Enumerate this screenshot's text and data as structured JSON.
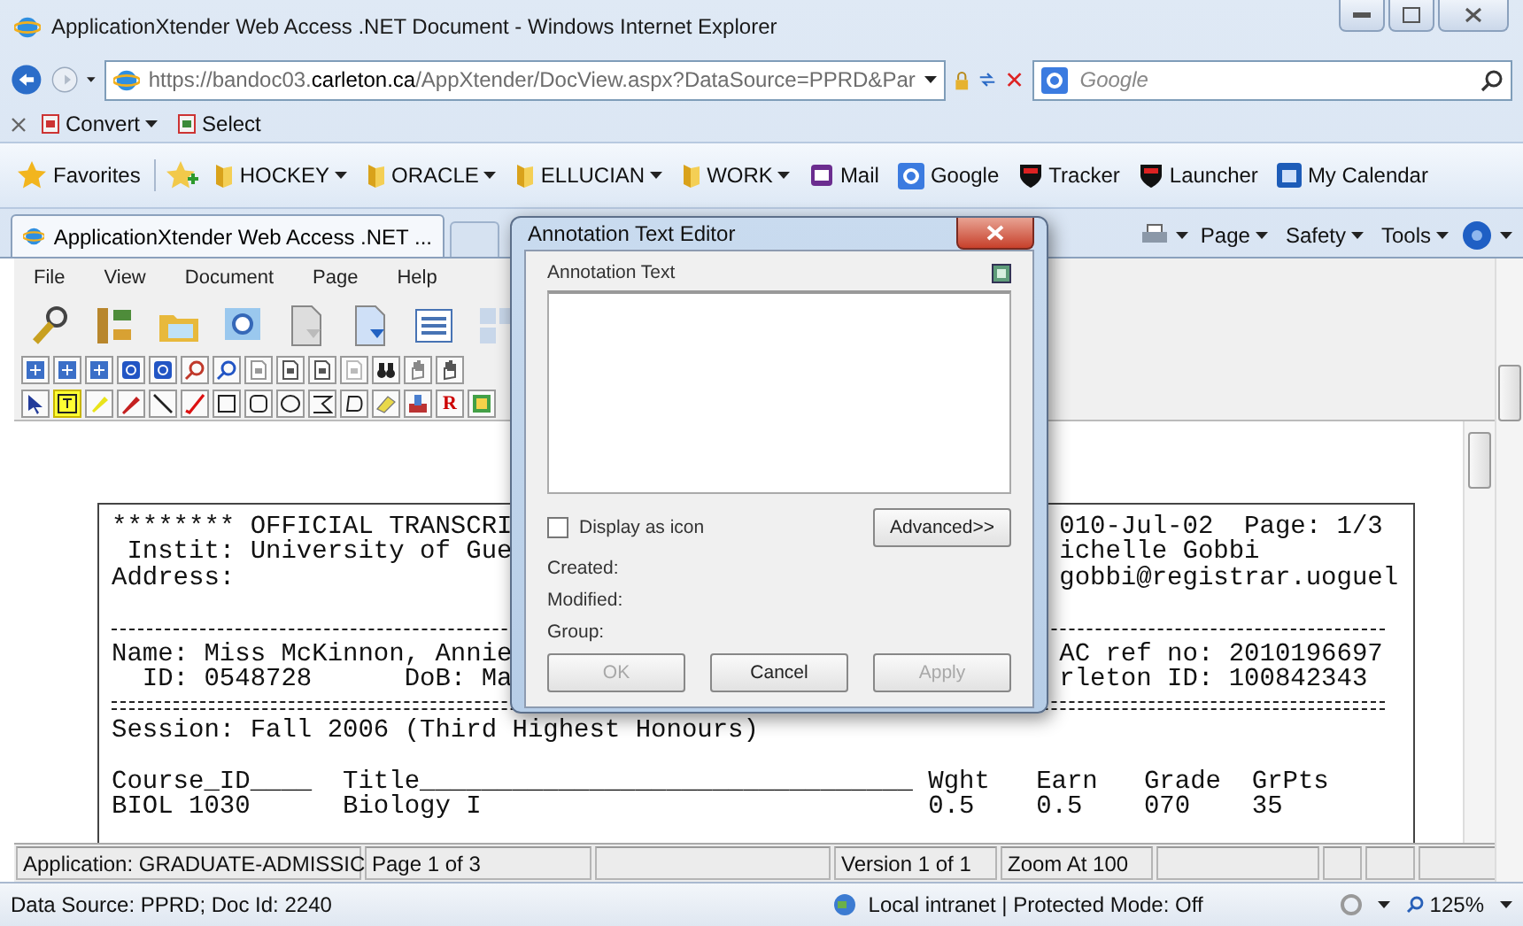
{
  "window": {
    "title": "ApplicationXtender Web Access .NET Document - Windows Internet Explorer"
  },
  "address_bar": {
    "url": "https://bandoc03.**carleton.ca**/AppXtender/DocView.aspx?DataSource=PPRD&Par"
  },
  "search": {
    "placeholder": "Google"
  },
  "command_bar": [
    {
      "label": "Convert",
      "has_menu": true
    },
    {
      "label": "Select",
      "has_menu": false
    }
  ],
  "favorites_bar": {
    "label": "Favorites",
    "items": [
      {
        "label": "HOCKEY",
        "kind": "folder",
        "has_menu": true
      },
      {
        "label": "ORACLE",
        "kind": "folder",
        "has_menu": true
      },
      {
        "label": "ELLUCIAN",
        "kind": "folder",
        "has_menu": true
      },
      {
        "label": "WORK",
        "kind": "folder",
        "has_menu": true
      },
      {
        "label": "Mail",
        "kind": "mail",
        "has_menu": false
      },
      {
        "label": "Google",
        "kind": "app",
        "has_menu": false
      },
      {
        "label": "Tracker",
        "kind": "shield",
        "has_menu": false
      },
      {
        "label": "Launcher",
        "kind": "shield",
        "has_menu": false
      },
      {
        "label": "My Calendar",
        "kind": "calendar",
        "has_menu": false
      }
    ]
  },
  "tabs": [
    {
      "label": "ApplicationXtender Web Access .NET ...",
      "selected": true
    }
  ],
  "ie_toolbar": [
    "Page",
    "Safety",
    "Tools"
  ],
  "app_menu": [
    "File",
    "View",
    "Document",
    "Page",
    "Help"
  ],
  "annotation_tools": [
    {
      "kind": "pointer",
      "selected": false
    },
    {
      "kind": "text",
      "selected": true
    },
    {
      "kind": "highlighter",
      "selected": false
    },
    {
      "kind": "marker",
      "selected": false
    },
    {
      "kind": "line",
      "selected": false
    },
    {
      "kind": "check",
      "selected": false
    },
    {
      "kind": "rectangle",
      "selected": false
    },
    {
      "kind": "rounded",
      "selected": false
    },
    {
      "kind": "ellipse",
      "selected": false
    },
    {
      "kind": "polygon",
      "selected": false
    },
    {
      "kind": "freeform",
      "selected": false
    },
    {
      "kind": "eraser",
      "selected": false
    },
    {
      "kind": "stamp",
      "selected": false
    },
    {
      "kind": "letter",
      "label": "R",
      "selected": false
    },
    {
      "kind": "image",
      "selected": false
    }
  ],
  "document": {
    "lines": [
      {
        "kind": "text",
        "left": "******** OFFICIAL TRANSCRI",
        "right": "010-Jul-02  Page: 1/3"
      },
      {
        "kind": "text",
        "left": " Instit: University of Gue",
        "right": "ichelle Gobbi"
      },
      {
        "kind": "text",
        "left": "Address:",
        "right": "gobbi@registrar.uoguel"
      },
      {
        "kind": "blank"
      },
      {
        "kind": "dash"
      },
      {
        "kind": "text",
        "left": "Name: Miss McKinnon, Annie",
        "right": "AC ref no: 2010196697"
      },
      {
        "kind": "text",
        "left": "  ID: 0548728      DoB: Ma",
        "right": "rleton ID: 100842343"
      },
      {
        "kind": "double"
      },
      {
        "kind": "text",
        "left": "Session: Fall 2006 (Third Highest Honours)"
      },
      {
        "kind": "blank"
      }
    ],
    "course_table": {
      "columns": [
        "Course_ID____",
        "Title________________________________",
        "Wght",
        "Earn",
        "Grade",
        "GrPts"
      ],
      "rows": [
        [
          "BIOL 1030",
          "Biology I",
          "0.5",
          "0.5",
          "070",
          "35"
        ]
      ]
    }
  },
  "app_status": [
    "Application: GRADUATE-ADMISSIC",
    "Page 1 of 3",
    "Version 1 of 1",
    "Zoom At 100"
  ],
  "ie_status": {
    "source": "Data Source: PPRD; Doc Id: 2240",
    "zone": "Local intranet | Protected Mode: Off",
    "zoom": "125%"
  },
  "dialog": {
    "title": "Annotation Text Editor",
    "text_label": "Annotation Text",
    "display_as_icon": {
      "label": "Display as icon",
      "checked": false
    },
    "advanced": "Advanced>>",
    "fields": [
      "Created:",
      "Modified:",
      "Group:"
    ],
    "buttons": [
      {
        "label": "OK",
        "disabled": true
      },
      {
        "label": "Cancel",
        "disabled": false
      },
      {
        "label": "Apply",
        "disabled": true
      }
    ]
  }
}
